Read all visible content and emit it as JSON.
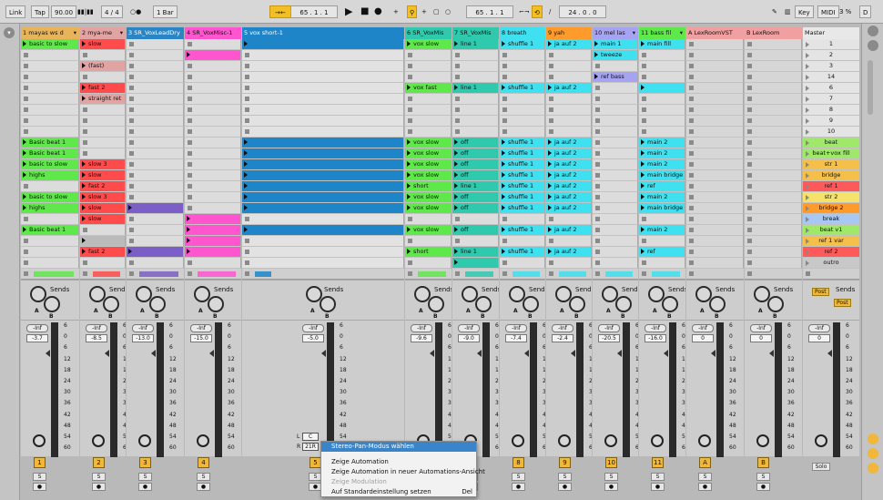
{
  "topbar": {
    "link": "Link",
    "tap": "Tap",
    "tempo": "90.00",
    "signature": "4 / 4",
    "quantize": "1 Bar",
    "position": "65 .  1 .  1",
    "position2": "65 .  1 .  1",
    "loop_length": "24 .  0 .  0",
    "key": "Key",
    "midi": "MIDI",
    "cpu": "3 %",
    "d": "D"
  },
  "colors": {
    "green": "#5fe84a",
    "red": "#ff4b4b",
    "pink": "#ff55cf",
    "blue": "#1e86c8",
    "teal": "#2fc9ae",
    "cyan": "#3fe0ef",
    "orange": "#ff9a2c",
    "lavender": "#a6a3f2",
    "olive": "#cda24e",
    "yellow": "#f5e26a",
    "purple": "#7b5fc6",
    "salmon": "#df8f8f",
    "lightpink": "#e2a3a3"
  },
  "tracks": [
    {
      "name": "1 mayas ws d",
      "color": "#e8b45b",
      "fold": true,
      "volume": "-3.7",
      "number": "1"
    },
    {
      "name": "2 mya-me",
      "color": "#e2a3a3",
      "fold": true,
      "volume": "-8.5",
      "number": "2"
    },
    {
      "name": "3 SR_VoxLeadDry",
      "color": "#7b5fc6",
      "fold": false,
      "volume": "-13.0",
      "number": "3"
    },
    {
      "name": "4 SR_VoxMisc-1",
      "color": "#ff55cf",
      "fold": false,
      "volume": "-15.0",
      "number": "4"
    },
    {
      "name": "5 vox short-1",
      "color": "#1e86c8",
      "fold": false,
      "volume": "-5.0",
      "number": "5",
      "pan": "C",
      "pan_r": "21R"
    },
    {
      "name": "6 SR_VoxMis",
      "color": "#2fc9ae",
      "fold": false,
      "volume": "-9.6",
      "number": "6"
    },
    {
      "name": "7 SR_VoxMis",
      "color": "#2fc9ae",
      "fold": false,
      "volume": "-9.0",
      "number": "7"
    },
    {
      "name": "8 breath",
      "color": "#3fe0ef",
      "fold": false,
      "volume": "-7.4",
      "number": "8"
    },
    {
      "name": "9 yah",
      "color": "#ff9a2c",
      "fold": false,
      "volume": "-2.4",
      "number": "9"
    },
    {
      "name": "10 mel las",
      "color": "#a6a3f2",
      "fold": true,
      "volume": "-20.5",
      "number": "10"
    },
    {
      "name": "11 bass fil",
      "color": "#5fe84a",
      "fold": true,
      "volume": "-16.0",
      "number": "11"
    },
    {
      "name": "A LexRoomVST",
      "color": "#f0a0a0",
      "fold": false,
      "volume": "0",
      "number": "A"
    },
    {
      "name": "B LexRoom",
      "color": "#f0a0a0",
      "fold": false,
      "volume": "0",
      "number": "B"
    }
  ],
  "master": {
    "name": "Master",
    "volume": "0",
    "post1": "Post",
    "post2": "Post",
    "solo": "Solo"
  },
  "scenes": [
    "1",
    "2",
    "3",
    "14",
    "6",
    "7",
    "8",
    "9",
    "10",
    "beat",
    "beat+vox fill",
    "str 1",
    "bridge",
    "ref 1",
    "str 2",
    "bridge 2",
    "break",
    "beat v1",
    "ref 1 var",
    "ref 2",
    "outro"
  ],
  "scene_colors": [
    "",
    "",
    "",
    "",
    "",
    "",
    "",
    "",
    "",
    "#9fe86a",
    "#9fe86a",
    "#f5c04a",
    "#f5c04a",
    "#ff5a5a",
    "#f5e26a",
    "#ff9a2c",
    "#a6c8f2",
    "#9fe86a",
    "#f5c04a",
    "#ff5a5a",
    "#c8c8c8"
  ],
  "clips": {
    "t1": {
      "0": "basic to slow",
      "9": "Basic beat 1",
      "10": "Basic beat 1",
      "11": "basic to slow",
      "12": "highs",
      "14": "basic to slow",
      "15": "highs",
      "17": "Basic beat 1"
    },
    "t2": {
      "0": "slow",
      "2": "(fast)",
      "4": "fast 2",
      "5": "straight ret",
      "11": "slow 3",
      "12": "slow",
      "13": "fast 2",
      "14": "slow 3",
      "15": "slow",
      "16": "slow",
      "18": "",
      "19": "fast 2"
    },
    "t6": {
      "0": "vox slow",
      "4": "vox fast",
      "9": "vox slow",
      "10": "vox slow",
      "11": "vox slow",
      "12": "vox slow",
      "13": "short",
      "14": "vox slow",
      "15": "vox slow",
      "17": "vox slow",
      "19": "short"
    },
    "t7": {
      "0": "line 1",
      "4": "line 1",
      "9": "off",
      "10": "off",
      "11": "off",
      "12": "off",
      "13": "line 1",
      "14": "off",
      "15": "off",
      "17": "off",
      "19": "line 1",
      "20": ""
    },
    "t8": {
      "0": "shuffle 1",
      "4": "shuffle 1",
      "9": "shuffle 1",
      "10": "shuffle 1",
      "11": "shuffle 1",
      "12": "shuffle 1",
      "13": "shuffle 1",
      "14": "shuffle 1",
      "15": "shuffle 1",
      "17": "shuffle 1",
      "19": "shuffle 1"
    },
    "t9": {
      "0": "ja auf 2",
      "4": "ja auf 2",
      "9": "ja auf 2",
      "10": "ja auf 2",
      "11": "ja auf 2",
      "12": "ja auf 2",
      "13": "ja auf 2",
      "14": "ja auf 2",
      "15": "ja auf 2",
      "17": "ja auf 2",
      "19": "ja auf 2"
    },
    "t10": {
      "0": "main 1",
      "1": "tweeze",
      "3": "ref bass"
    },
    "t11": {
      "0": "main fill",
      "4": "",
      "9": "main 2",
      "10": "main 2",
      "11": "main 2",
      "12": "main bridge",
      "13": "ref",
      "14": "main 2",
      "15": "main bridge",
      "17": "main 2",
      "19": "ref"
    }
  },
  "sends_label": "Sends",
  "inf": "-Inf",
  "scale": [
    "6",
    "0",
    "6",
    "12",
    "18",
    "24",
    "30",
    "36",
    "42",
    "48",
    "54",
    "60"
  ],
  "context_menu": {
    "items": [
      {
        "label": "Stereo-Pan-Modus wählen",
        "highlighted": true,
        "disabled": false,
        "shortcut": ""
      },
      {
        "label": "Zeige Automation",
        "highlighted": false,
        "disabled": false,
        "shortcut": ""
      },
      {
        "label": "Zeige Automation in neuer Automations-Ansicht",
        "highlighted": false,
        "disabled": false,
        "shortcut": ""
      },
      {
        "label": "Zeige Modulation",
        "highlighted": false,
        "disabled": true,
        "shortcut": ""
      },
      {
        "label": "Auf Standardeinstellung setzen",
        "highlighted": false,
        "disabled": false,
        "shortcut": "Del"
      }
    ]
  }
}
